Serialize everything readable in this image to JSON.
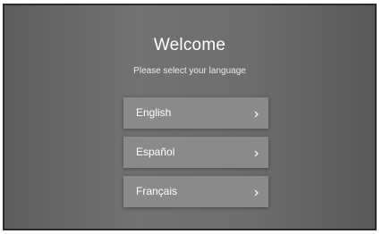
{
  "welcome": {
    "title": "Welcome",
    "subtitle": "Please select your language"
  },
  "languages": [
    {
      "label": "English",
      "icon": "chevron-right-icon"
    },
    {
      "label": "Español",
      "icon": "chevron-right-icon"
    },
    {
      "label": "Français",
      "icon": "chevron-right-icon"
    }
  ],
  "colors": {
    "background": "#6a6a6a",
    "button": "#8a8a8a",
    "text": "#ffffff"
  }
}
